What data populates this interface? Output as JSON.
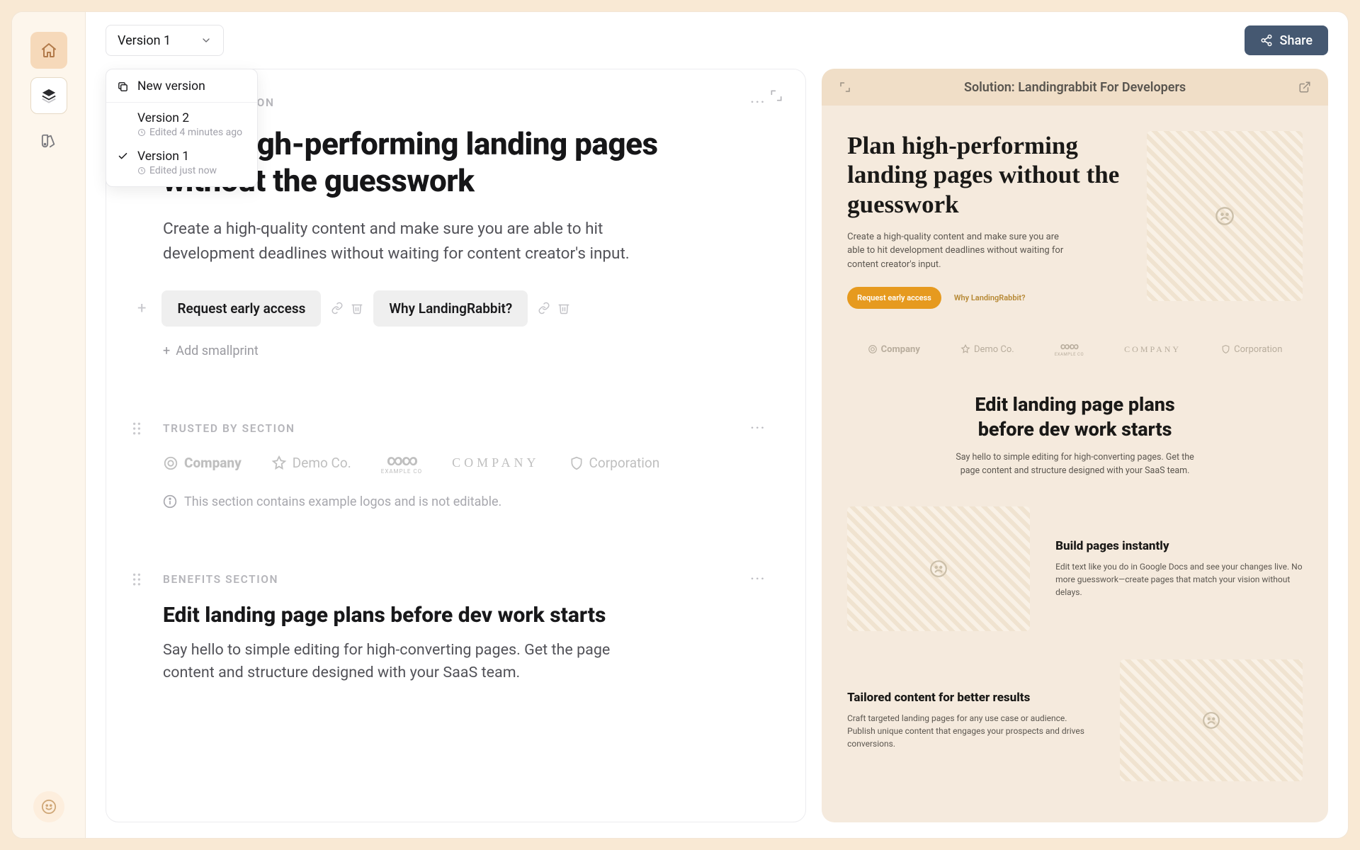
{
  "sidebar": {
    "home": "home",
    "layers": "layers",
    "swatch": "swatch"
  },
  "topbar": {
    "version_label": "Version 1",
    "share_label": "Share"
  },
  "version_dropdown": {
    "new_version": "New version",
    "items": [
      {
        "label": "Version 2",
        "meta": "Edited 4 minutes ago",
        "selected": false
      },
      {
        "label": "Version 1",
        "meta": "Edited just now",
        "selected": true
      }
    ]
  },
  "editor": {
    "landing": {
      "section_label": "LANDING SECTION",
      "headline": "Plan high-performing landing pages without the guesswork",
      "subhead": "Create a high-quality content and make sure you are able to hit development deadlines without waiting for content creator's input.",
      "cta1": "Request early access",
      "cta2": "Why LandingRabbit?",
      "add_smallprint": "Add smallprint"
    },
    "trusted": {
      "section_label": "TRUSTED BY SECTION",
      "logos": [
        "Company",
        "Demo Co.",
        "EXAMPLE CO",
        "COMPANY",
        "Corporation"
      ],
      "note": "This section contains example logos and is not editable."
    },
    "benefits": {
      "section_label": "BENEFITS SECTION",
      "headline": "Edit landing page plans before dev work starts",
      "subhead": "Say hello to simple editing for high-converting pages. Get the page content and structure designed with your SaaS team."
    }
  },
  "preview": {
    "header": "Solution: Landingrabbit For Developers",
    "hero_h1": "Plan high-performing landing pages without the guesswork",
    "hero_sub": "Create a high-quality content and make sure you are able to hit development deadlines without waiting for content creator's input.",
    "cta_primary": "Request early access",
    "cta_secondary": "Why LandingRabbit?",
    "logos": [
      "Company",
      "Demo Co.",
      "EXAMPLE CO",
      "COMPANY",
      "Corporation"
    ],
    "benefits_title": "Edit landing page plans before dev work starts",
    "benefits_sub": "Say hello to simple editing for high-converting pages. Get the page content and structure designed with your SaaS team.",
    "feature1_h": "Build pages instantly",
    "feature1_p": "Edit text like you do in Google Docs and see your changes live. No more guesswork—create pages that match your vision without delays.",
    "feature2_h": "Tailored content for better results",
    "feature2_p": "Craft targeted landing pages for any use case or audience. Publish unique content that engages your prospects and drives conversions."
  }
}
